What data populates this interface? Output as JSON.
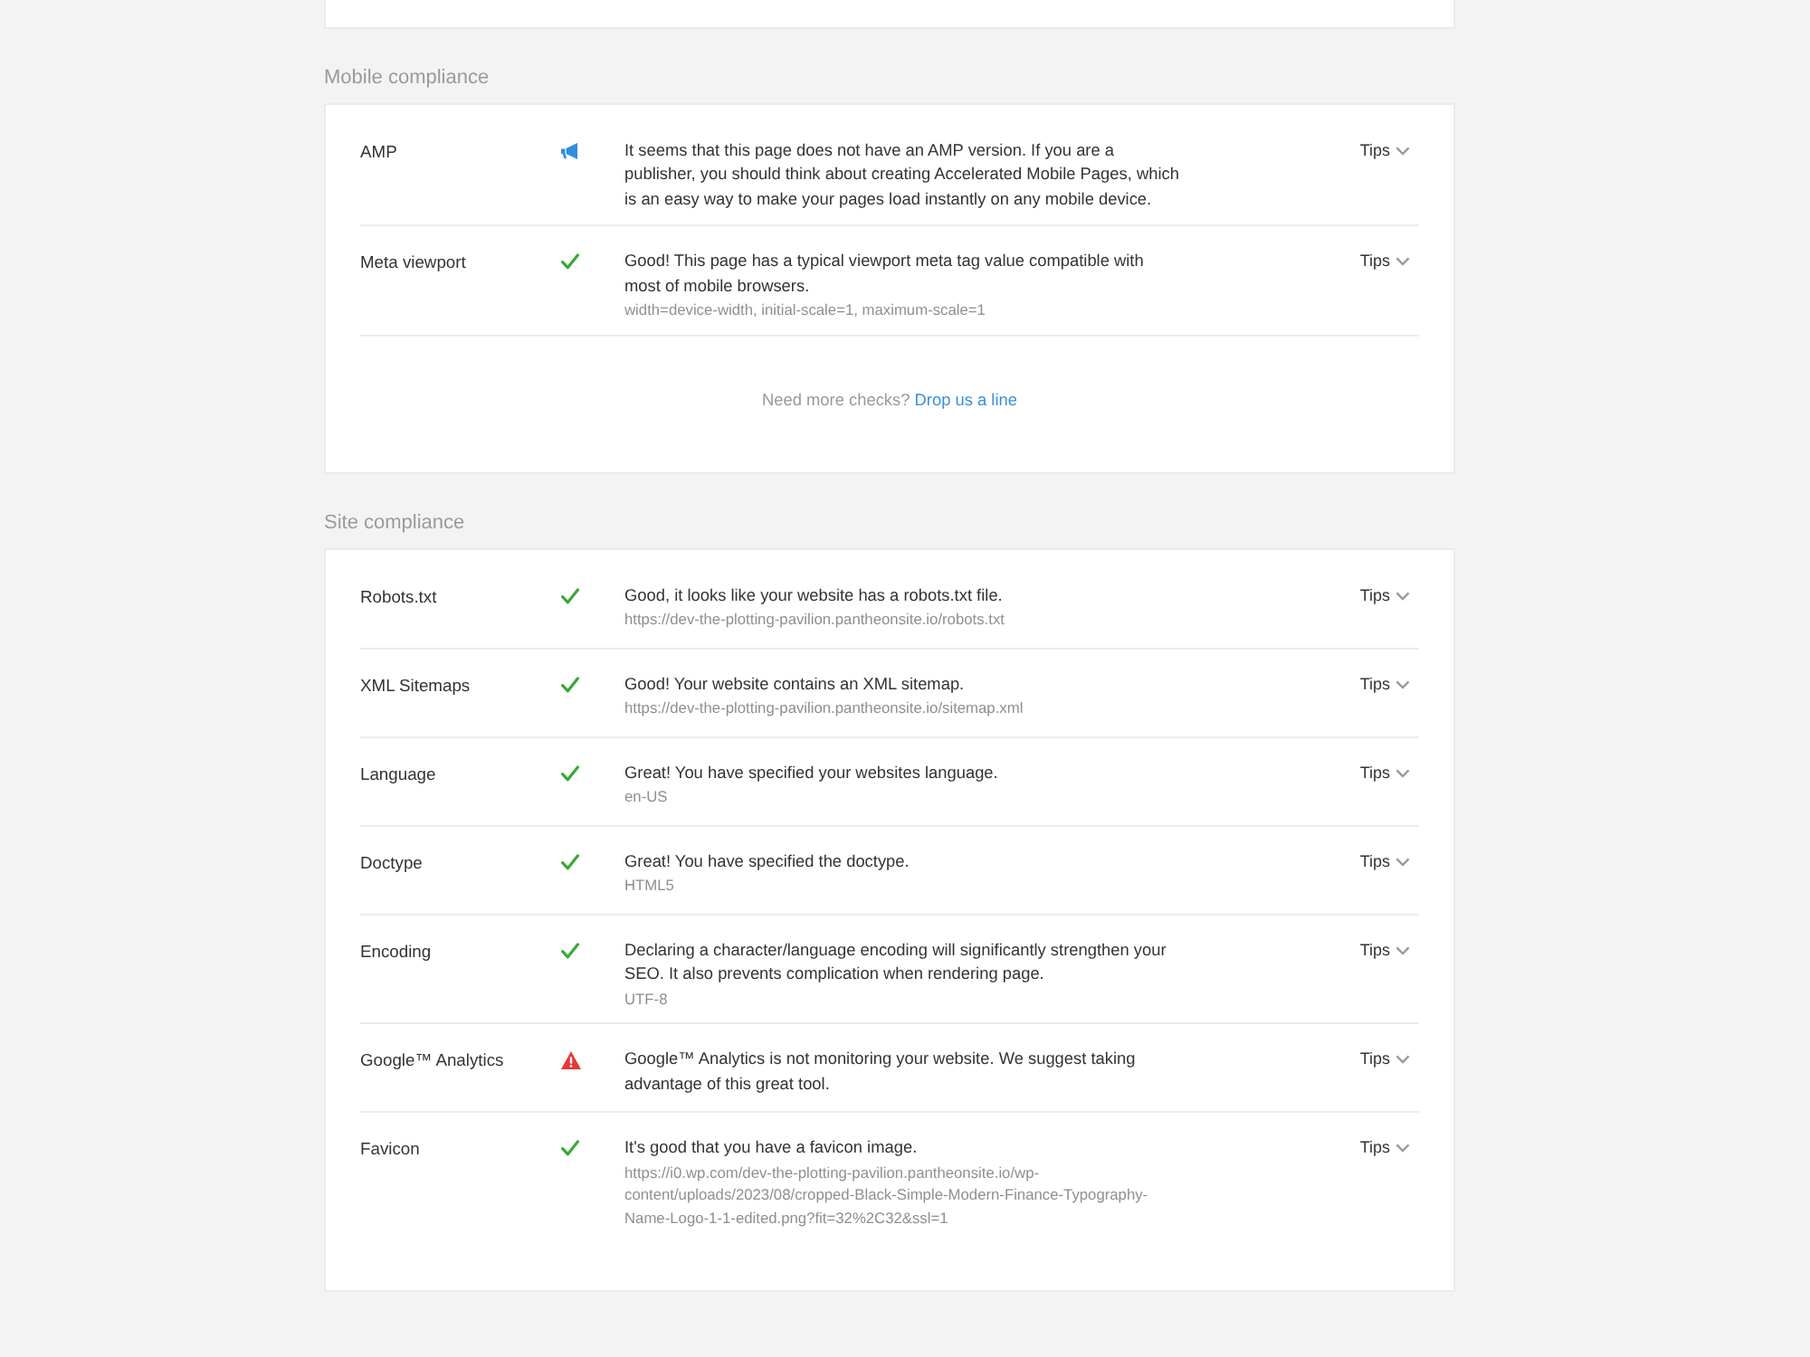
{
  "sections": [
    {
      "title": "Mobile compliance",
      "checks": [
        {
          "name": "AMP",
          "kind": "info",
          "message": "It seems that this page does not have an AMP version. If you are a publisher, you should think about creating Accelerated Mobile Pages, which is an easy way to make your pages load instantly on any mobile device.",
          "tips": "Tips"
        },
        {
          "name": "Meta viewport",
          "kind": "pass",
          "message": "Good! This page has a typical viewport meta tag value compatible with most of mobile browsers.",
          "detail": "width=device-width, initial-scale=1, maximum-scale=1",
          "tips": "Tips"
        }
      ],
      "footer": {
        "text": "Need more checks?",
        "link": "Drop us a line"
      }
    },
    {
      "title": "Site compliance",
      "checks": [
        {
          "name": "Robots.txt",
          "kind": "pass",
          "message": "Good, it looks like your website has a robots.txt file.",
          "detail": "https://dev-the-plotting-pavilion.pantheonsite.io/robots.txt",
          "tips": "Tips"
        },
        {
          "name": "XML Sitemaps",
          "kind": "pass",
          "message": "Good! Your website contains an XML sitemap.",
          "detail": "https://dev-the-plotting-pavilion.pantheonsite.io/sitemap.xml",
          "tips": "Tips"
        },
        {
          "name": "Language",
          "kind": "pass",
          "message": "Great! You have specified your websites language.",
          "detail": "en-US",
          "tips": "Tips"
        },
        {
          "name": "Doctype",
          "kind": "pass",
          "message": "Great! You have specified the doctype.",
          "detail": "HTML5",
          "tips": "Tips"
        },
        {
          "name": "Encoding",
          "kind": "pass",
          "message": "Declaring a character/language encoding will significantly strengthen your SEO. It also prevents complication when rendering page.",
          "detail": "UTF-8",
          "tips": "Tips"
        },
        {
          "name": "Google™ Analytics",
          "kind": "warning",
          "message": "Google™ Analytics is not monitoring your website. We suggest taking advantage of this great tool.",
          "tips": "Tips"
        },
        {
          "name": "Favicon",
          "kind": "pass",
          "message": "It's good that you have a favicon image.",
          "detail": "https://i0.wp.com/dev-the-plotting-pavilion.pantheonsite.io/wp-content/uploads/2023/08/cropped-Black-Simple-Modern-Finance-Typography-Name-Logo-1-1-edited.png?fit=32%2C32&ssl=1",
          "tips": "Tips"
        }
      ]
    }
  ]
}
